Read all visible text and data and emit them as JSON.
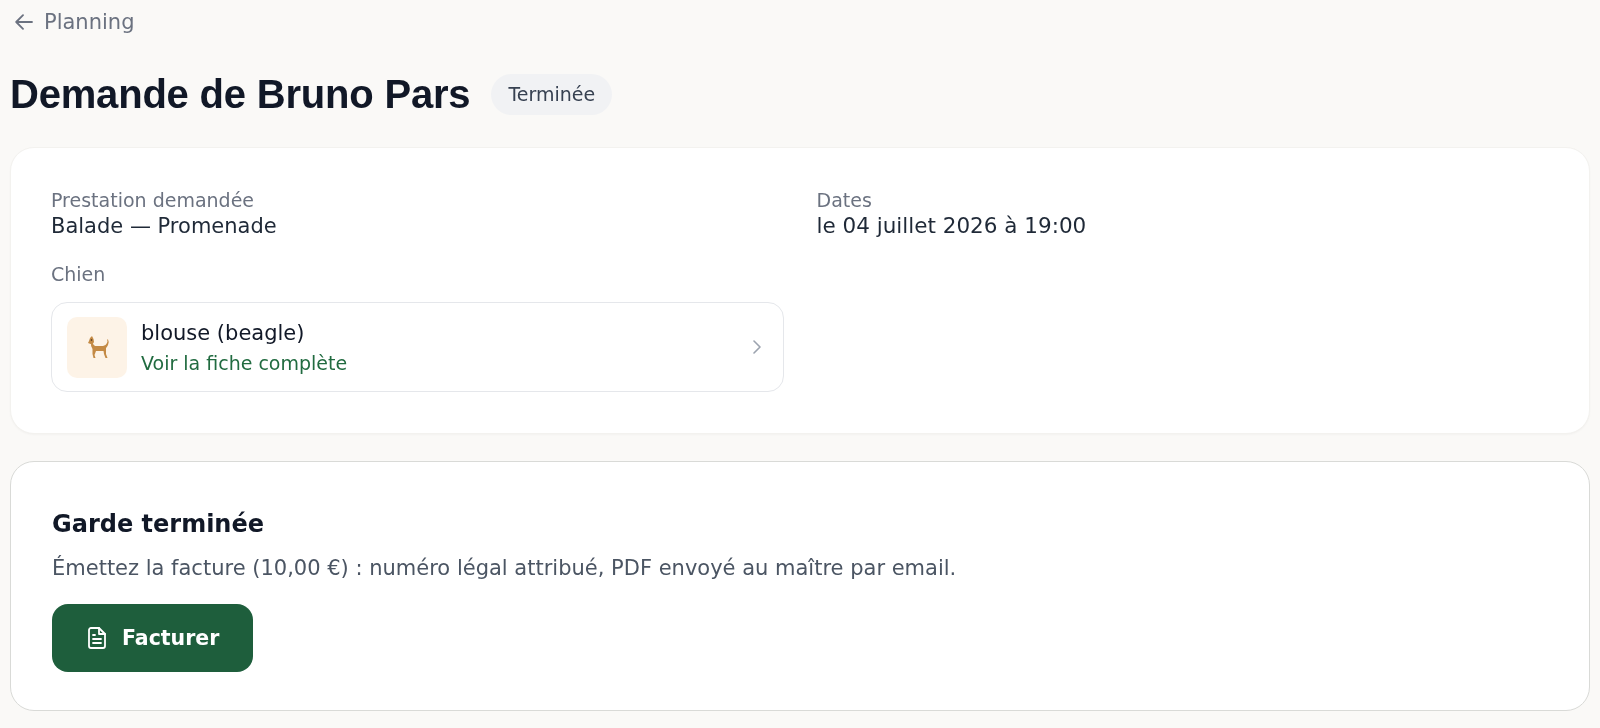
{
  "back_link": {
    "label": "Planning"
  },
  "header": {
    "title": "Demande de Bruno Pars",
    "status_badge": "Terminée"
  },
  "details": {
    "fields": [
      {
        "label": "Prestation demandée",
        "value": "Balade — Promenade"
      },
      {
        "label": "Dates",
        "value": "le 04 juillet 2026 à 19:00"
      }
    ],
    "dog_section": {
      "label": "Chien",
      "dog": {
        "name": "blouse (beagle)",
        "link": "Voir la fiche complète"
      }
    }
  },
  "action_card": {
    "title": "Garde terminée",
    "description": "Émettez la facture (10,00 €) : numéro légal attribué, PDF envoyé au maître par email.",
    "button": "Facturer"
  }
}
